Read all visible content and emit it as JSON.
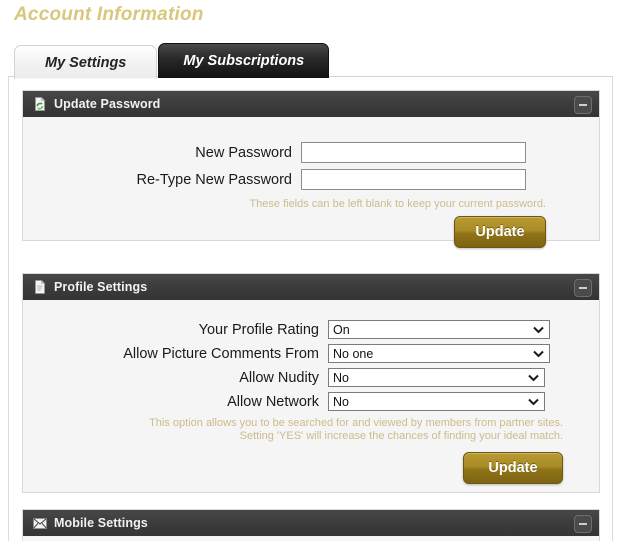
{
  "page": {
    "title": "Account Information"
  },
  "tabs": [
    {
      "label": "My Settings",
      "state": "active"
    },
    {
      "label": "My Subscriptions",
      "state": "inactive"
    }
  ],
  "panels": {
    "update_password": {
      "title": "Update Password",
      "icon": "page-refresh-icon",
      "collapse_label": "−",
      "fields": [
        {
          "label": "New Password",
          "value": "",
          "placeholder": ""
        },
        {
          "label": "Re-Type New Password",
          "value": "",
          "placeholder": ""
        }
      ],
      "hint": "These fields can be left blank to keep your current password.",
      "button_label": "Update"
    },
    "profile_settings": {
      "title": "Profile Settings",
      "icon": "page-icon",
      "collapse_label": "−",
      "rows": [
        {
          "label": "Your Profile Rating",
          "value": "On"
        },
        {
          "label": "Allow Picture Comments From",
          "value": "No one"
        },
        {
          "label": "Allow Nudity",
          "value": "No"
        },
        {
          "label": "Allow Network",
          "value": "No"
        }
      ],
      "hint_line1": "This option allows you to be searched for and viewed by members from partner sites.",
      "hint_line2": "Setting 'YES' will increase the chances of finding your ideal match.",
      "button_label": "Update"
    },
    "mobile_settings": {
      "title": "Mobile Settings",
      "icon": "envelope-icon",
      "collapse_label": "−"
    }
  },
  "colors": {
    "title_gold": "#d8c77c",
    "hint_tan": "#cdbb8b",
    "panel_header_dark": "#3c3c3c",
    "button_gold": "#a98b27",
    "tab_active_bg": "#f2f2f2",
    "tab_inactive_bg": "#1a1a1a"
  }
}
